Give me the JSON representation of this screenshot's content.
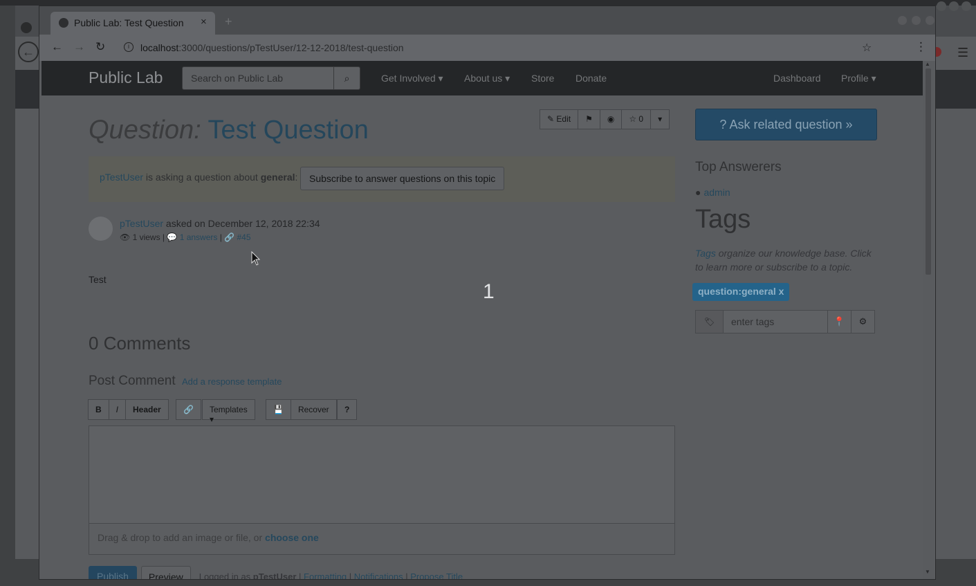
{
  "browser": {
    "tab_title": "Public Lab: Test Question",
    "tab_close": "×",
    "url_host": "localhost",
    "url_path": ":3000/questions/pTestUser/12-12-2018/test-question"
  },
  "nav": {
    "brand": "Public Lab",
    "search_placeholder": "Search on Public Lab",
    "links": [
      "Get Involved ▾",
      "About us ▾",
      "Store",
      "Donate"
    ],
    "dashboard": "Dashboard",
    "profile": "Profile ▾"
  },
  "question": {
    "prefix": "Question:",
    "title": "Test Question",
    "toolbar": {
      "edit": "Edit",
      "likes": "0"
    },
    "asker": "pTestUser",
    "asking_text": " is asking a question about ",
    "topic": "general",
    "subscribe": "Subscribe to answer questions on this topic",
    "asked_on": " asked on December 12, 2018 22:34",
    "views": "1 views | ",
    "answers": "1 answers",
    "sep": " | ",
    "node_id": "#45",
    "body": "Test",
    "overlay_count": "1"
  },
  "comments": {
    "heading": "0 Comments",
    "post_heading": "Post Comment",
    "template_link": "Add a response template",
    "toolbar": {
      "bold": "B",
      "italic": "I",
      "header": "Header",
      "templates": "Templates ▾",
      "recover": "Recover",
      "help": "?"
    },
    "drop_text": "Drag & drop to add an image or file, or ",
    "choose": "choose one",
    "publish": "Publish",
    "preview": "Preview",
    "logged_in_prefix": "Logged in as ",
    "logged_user": "pTestUser",
    "footer_links": [
      "Formatting",
      "Notifications",
      "Propose Title"
    ]
  },
  "sidebar": {
    "ask_button": "Ask related question »",
    "top_answerers": "Top Answerers",
    "answerer": "admin",
    "tags_heading": "Tags",
    "tags_link": "Tags",
    "tags_desc": " organize our knowledge base. Click to learn more or subscribe to a topic.",
    "tag_chip": "question:general x",
    "tag_placeholder": "enter tags"
  },
  "colors": {
    "brand_blue": "#24465b",
    "nav_bg": "#242628"
  }
}
